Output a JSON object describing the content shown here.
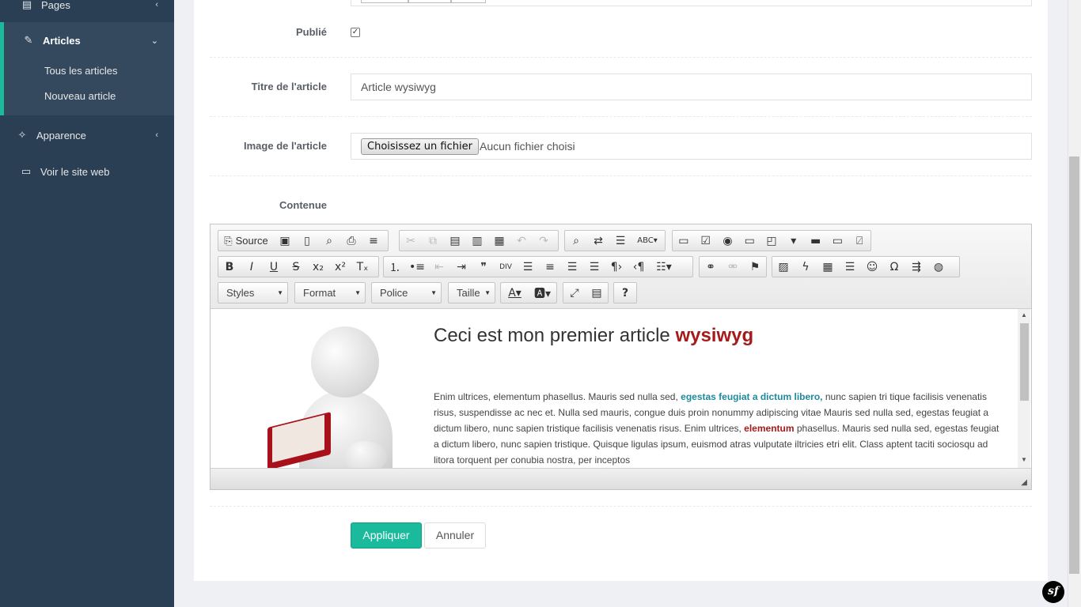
{
  "sidebar": {
    "pages": "Pages",
    "articles": "Articles",
    "sub_items": [
      "Tous les articles",
      "Nouveau article"
    ],
    "apparence": "Apparence",
    "voir_site": "Voir le site web"
  },
  "form": {
    "publie_label": "Publié",
    "publie_checked": true,
    "titre_label": "Titre de l'article",
    "titre_value": "Article wysiwyg",
    "image_label": "Image de l'article",
    "file_button": "Choisissez un fichier",
    "file_status": "Aucun fichier choisi",
    "contenue_label": "Contenue"
  },
  "editor": {
    "source_label": "Source",
    "combos": [
      "Styles",
      "Format",
      "Police",
      "Taille"
    ],
    "help": "?",
    "content": {
      "title_plain": "Ceci est mon premier article ",
      "title_highlight": "wysiwyg",
      "body_1": "Enim ultrices, elementum phasellus. Mauris sed nulla sed, ",
      "body_teal": "egestas feugiat a dictum libero,",
      "body_2": " nunc sapien tri tique facilisis venenatis risus, suspendisse ac nec et. Nulla sed mauris, congue duis proin nonummy adipiscing vitae Mauris sed nulla sed, egestas feugiat a dictum libero, nunc sapien tristique facilisis venenatis risus. Enim ultrices, ",
      "body_red": "elementum",
      "body_3": " phasellus. Mauris sed nulla sed, egestas feugiat a dictum libero, nunc sapien tristique. Quisque ligulas ipsum, euismod atras vulputate iltricies etri elit. Class aptent taciti sociosqu ad litora torquent per conubia nostra, per inceptos"
    }
  },
  "actions": {
    "apply": "Appliquer",
    "cancel": "Annuler"
  },
  "colors": {
    "sidebar": "#2a3f54",
    "accent": "#1abb9c",
    "highlight_red": "#a51b1b",
    "highlight_teal": "#1f8a9b"
  },
  "footer_badge": "sf"
}
